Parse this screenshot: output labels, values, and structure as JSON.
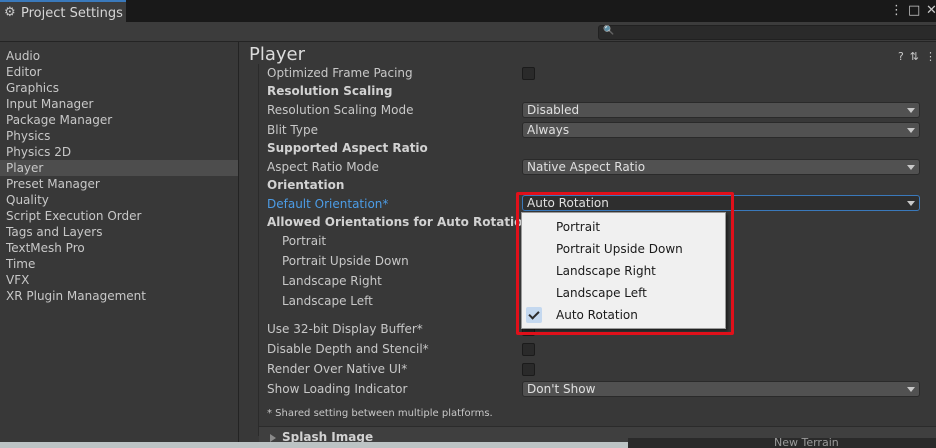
{
  "window": {
    "tab_title": "Project Settings",
    "icons": [
      "more-icon",
      "maximize-icon",
      "close-icon"
    ],
    "icon_glyphs": [
      "⋮",
      "□",
      "✕"
    ]
  },
  "search": {
    "placeholder": ""
  },
  "sidebar": {
    "items": [
      {
        "label": "Audio",
        "selected": false
      },
      {
        "label": "Editor",
        "selected": false
      },
      {
        "label": "Graphics",
        "selected": false
      },
      {
        "label": "Input Manager",
        "selected": false
      },
      {
        "label": "Package Manager",
        "selected": false
      },
      {
        "label": "Physics",
        "selected": false
      },
      {
        "label": "Physics 2D",
        "selected": false
      },
      {
        "label": "Player",
        "selected": true
      },
      {
        "label": "Preset Manager",
        "selected": false
      },
      {
        "label": "Quality",
        "selected": false
      },
      {
        "label": "Script Execution Order",
        "selected": false
      },
      {
        "label": "Tags and Layers",
        "selected": false
      },
      {
        "label": "TextMesh Pro",
        "selected": false
      },
      {
        "label": "Time",
        "selected": false
      },
      {
        "label": "VFX",
        "selected": false
      },
      {
        "label": "XR Plugin Management",
        "selected": false
      }
    ]
  },
  "main": {
    "title": "Player",
    "header_icons": [
      "help-icon",
      "preset-icon",
      "menu-icon"
    ],
    "header_icon_glyphs": [
      "?",
      "⇅",
      "⋮"
    ],
    "rows": {
      "optimized_frame_pacing": "Optimized Frame Pacing",
      "resolution_scaling": "Resolution Scaling",
      "resolution_scaling_mode": "Resolution Scaling Mode",
      "resolution_scaling_mode_value": "Disabled",
      "blit_type": "Blit Type",
      "blit_type_value": "Always",
      "supported_aspect_ratio": "Supported Aspect Ratio",
      "aspect_ratio_mode": "Aspect Ratio Mode",
      "aspect_ratio_mode_value": "Native Aspect Ratio",
      "orientation": "Orientation",
      "default_orientation": "Default Orientation*",
      "default_orientation_value": "Auto Rotation",
      "allowed_orientations": "Allowed Orientations for Auto Rotation",
      "portrait": "Portrait",
      "portrait_upside_down": "Portrait Upside Down",
      "landscape_right": "Landscape Right",
      "landscape_left": "Landscape Left",
      "use_32bit_display_buffer": "Use 32-bit Display Buffer*",
      "disable_depth_and_stencil": "Disable Depth and Stencil*",
      "render_over_native_ui": "Render Over Native UI*",
      "show_loading_indicator": "Show Loading Indicator",
      "show_loading_indicator_value": "Don't Show"
    },
    "footnote": "* Shared setting between multiple platforms.",
    "splash_image": "Splash Image"
  },
  "popup": {
    "options": [
      {
        "label": "Portrait",
        "checked": false
      },
      {
        "label": "Portrait Upside Down",
        "checked": false
      },
      {
        "label": "Landscape Right",
        "checked": false
      },
      {
        "label": "Landscape Left",
        "checked": false
      },
      {
        "label": "Auto Rotation",
        "checked": true
      }
    ]
  },
  "bottom": {
    "label": "New Terrain"
  },
  "colors": {
    "accent": "#3a79bb",
    "highlight_box": "#e0101a",
    "link_label": "#4c9ce6"
  }
}
